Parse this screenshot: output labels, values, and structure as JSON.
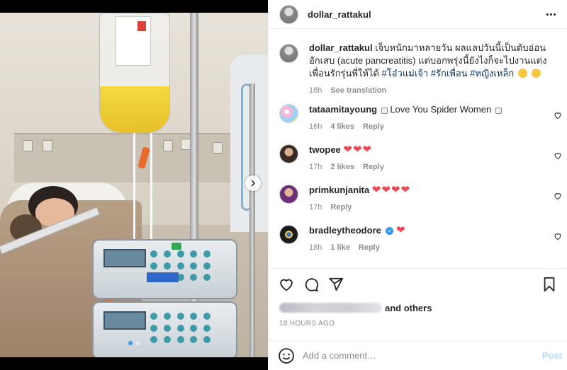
{
  "post": {
    "username": "dollar_rattakul"
  },
  "caption": {
    "username": "dollar_rattakul",
    "text": "เจ็บหนักมาหลายวัน ผลแลปวันนี้เป็นตับอ่อนอักเสบ (acute pancreatitis) แต่บอกพรุ่งนี้ยังไงก็จะไปงานแต่งเพื่อนรักรุ่นพี่ให้ได้",
    "hashtags": "#โอ๋วแม่เจ้า #รักเพื่อน #หญิงเหล็ก",
    "time": "18h",
    "see_translation": "See translation"
  },
  "comments": [
    {
      "username": "tataamitayoung",
      "text": "Love You Spider Women",
      "time": "16h",
      "likes": "4 likes",
      "reply": "Reply"
    },
    {
      "username": "twopee",
      "text": "❤❤❤",
      "time": "17h",
      "likes": "2 likes",
      "reply": "Reply"
    },
    {
      "username": "primkunjanita",
      "text": "❤❤❤❤",
      "time": "17h",
      "likes": "",
      "reply": "Reply"
    },
    {
      "username": "bradleytheodore",
      "text": "❤",
      "time": "18h",
      "likes": "1 like",
      "reply": "Reply"
    }
  ],
  "likes": {
    "suffix": "and others"
  },
  "timestamp": "18 HOURS AGO",
  "add_comment": {
    "placeholder": "Add a comment…",
    "post_label": "Post"
  },
  "colors": {
    "link": "#00376b",
    "post_disabled": "#b2dffc",
    "heart": "#ed4956",
    "verified": "#3897f0"
  }
}
